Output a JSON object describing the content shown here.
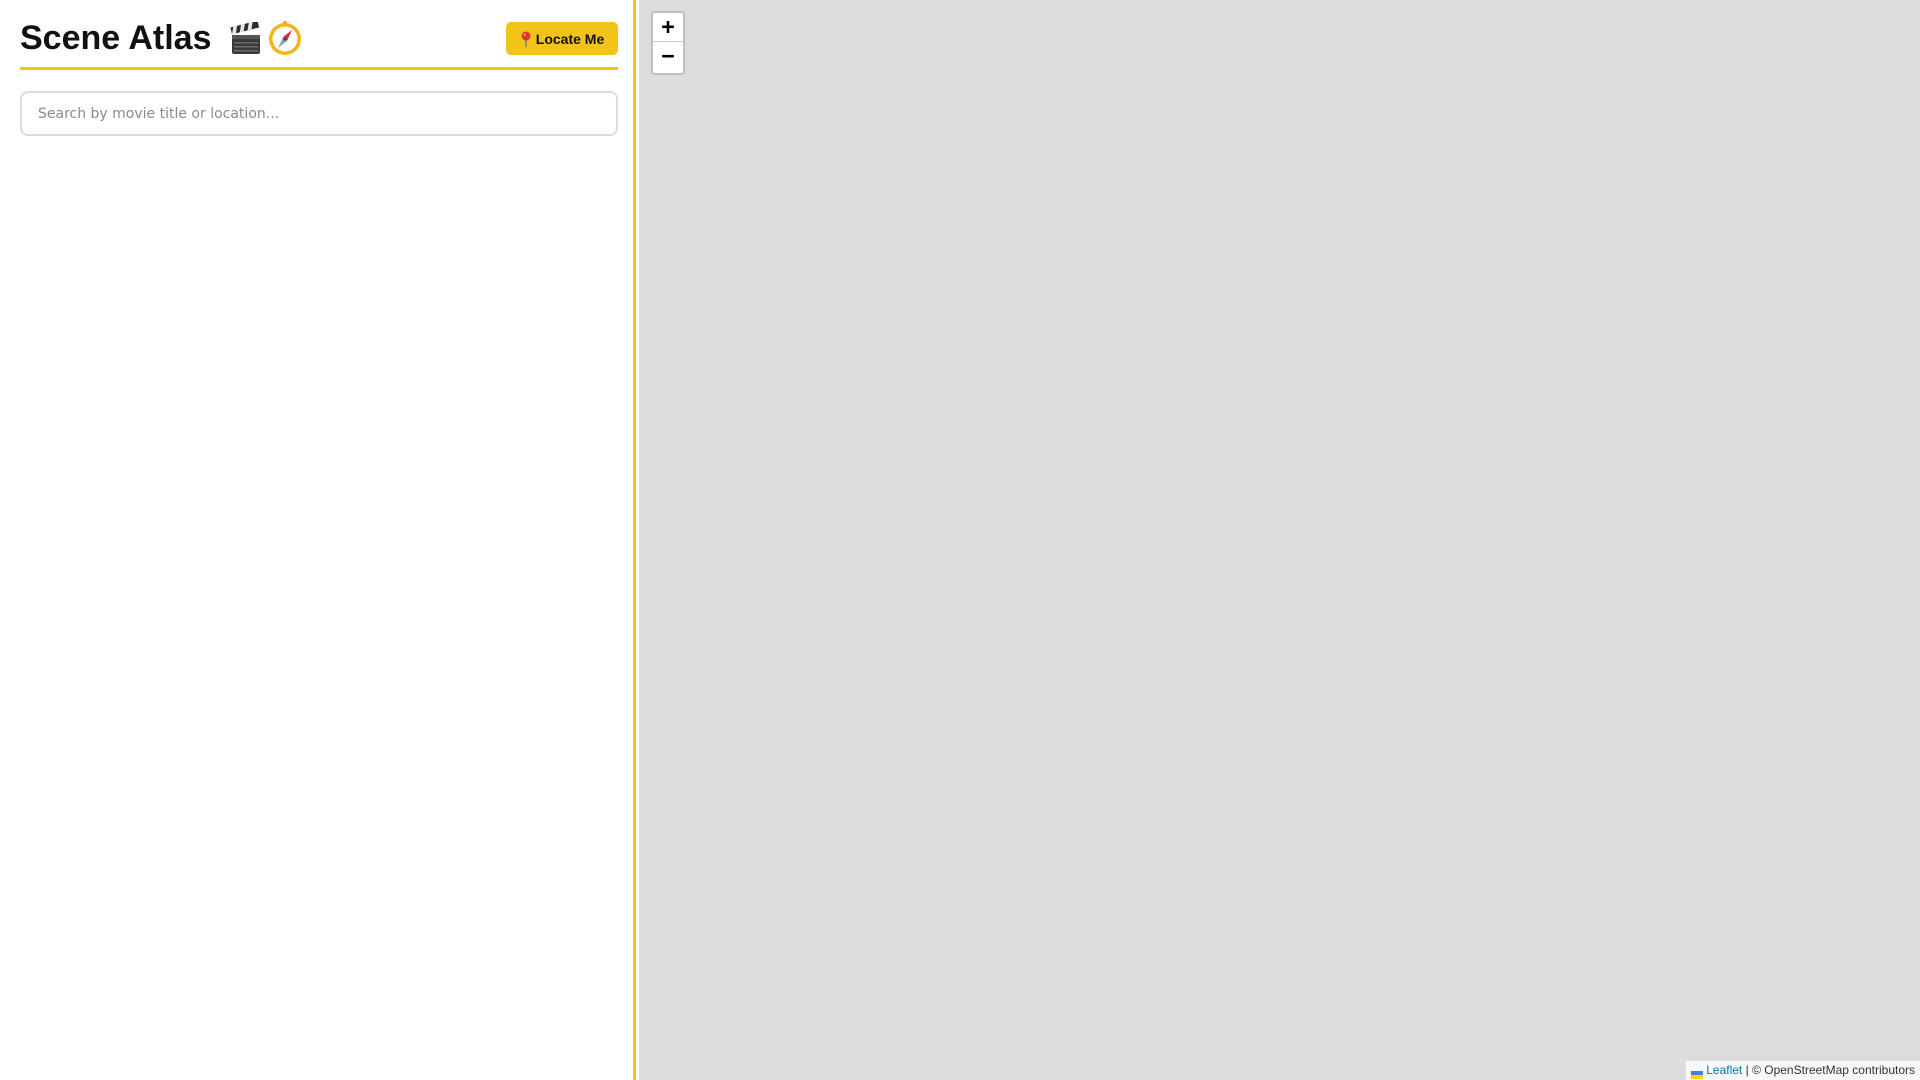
{
  "sidebar": {
    "title": "Scene Atlas",
    "title_icons": [
      "clapper-board-icon",
      "compass-icon"
    ],
    "locate_button": {
      "icon": "round-pushpin-icon",
      "label": "Locate Me"
    },
    "search": {
      "placeholder": "Search by movie title or location...",
      "value": ""
    },
    "results": []
  },
  "map": {
    "zoom_in_label": "+",
    "zoom_out_label": "−",
    "attribution": {
      "flag_icon": "ukraine-flag-icon",
      "leaflet_label": "Leaflet",
      "separator": "|",
      "osm_text": "© OpenStreetMap contributors"
    }
  },
  "colors": {
    "accent": "#f2c418",
    "map_background": "#dddddd",
    "link": "#0078a8"
  }
}
